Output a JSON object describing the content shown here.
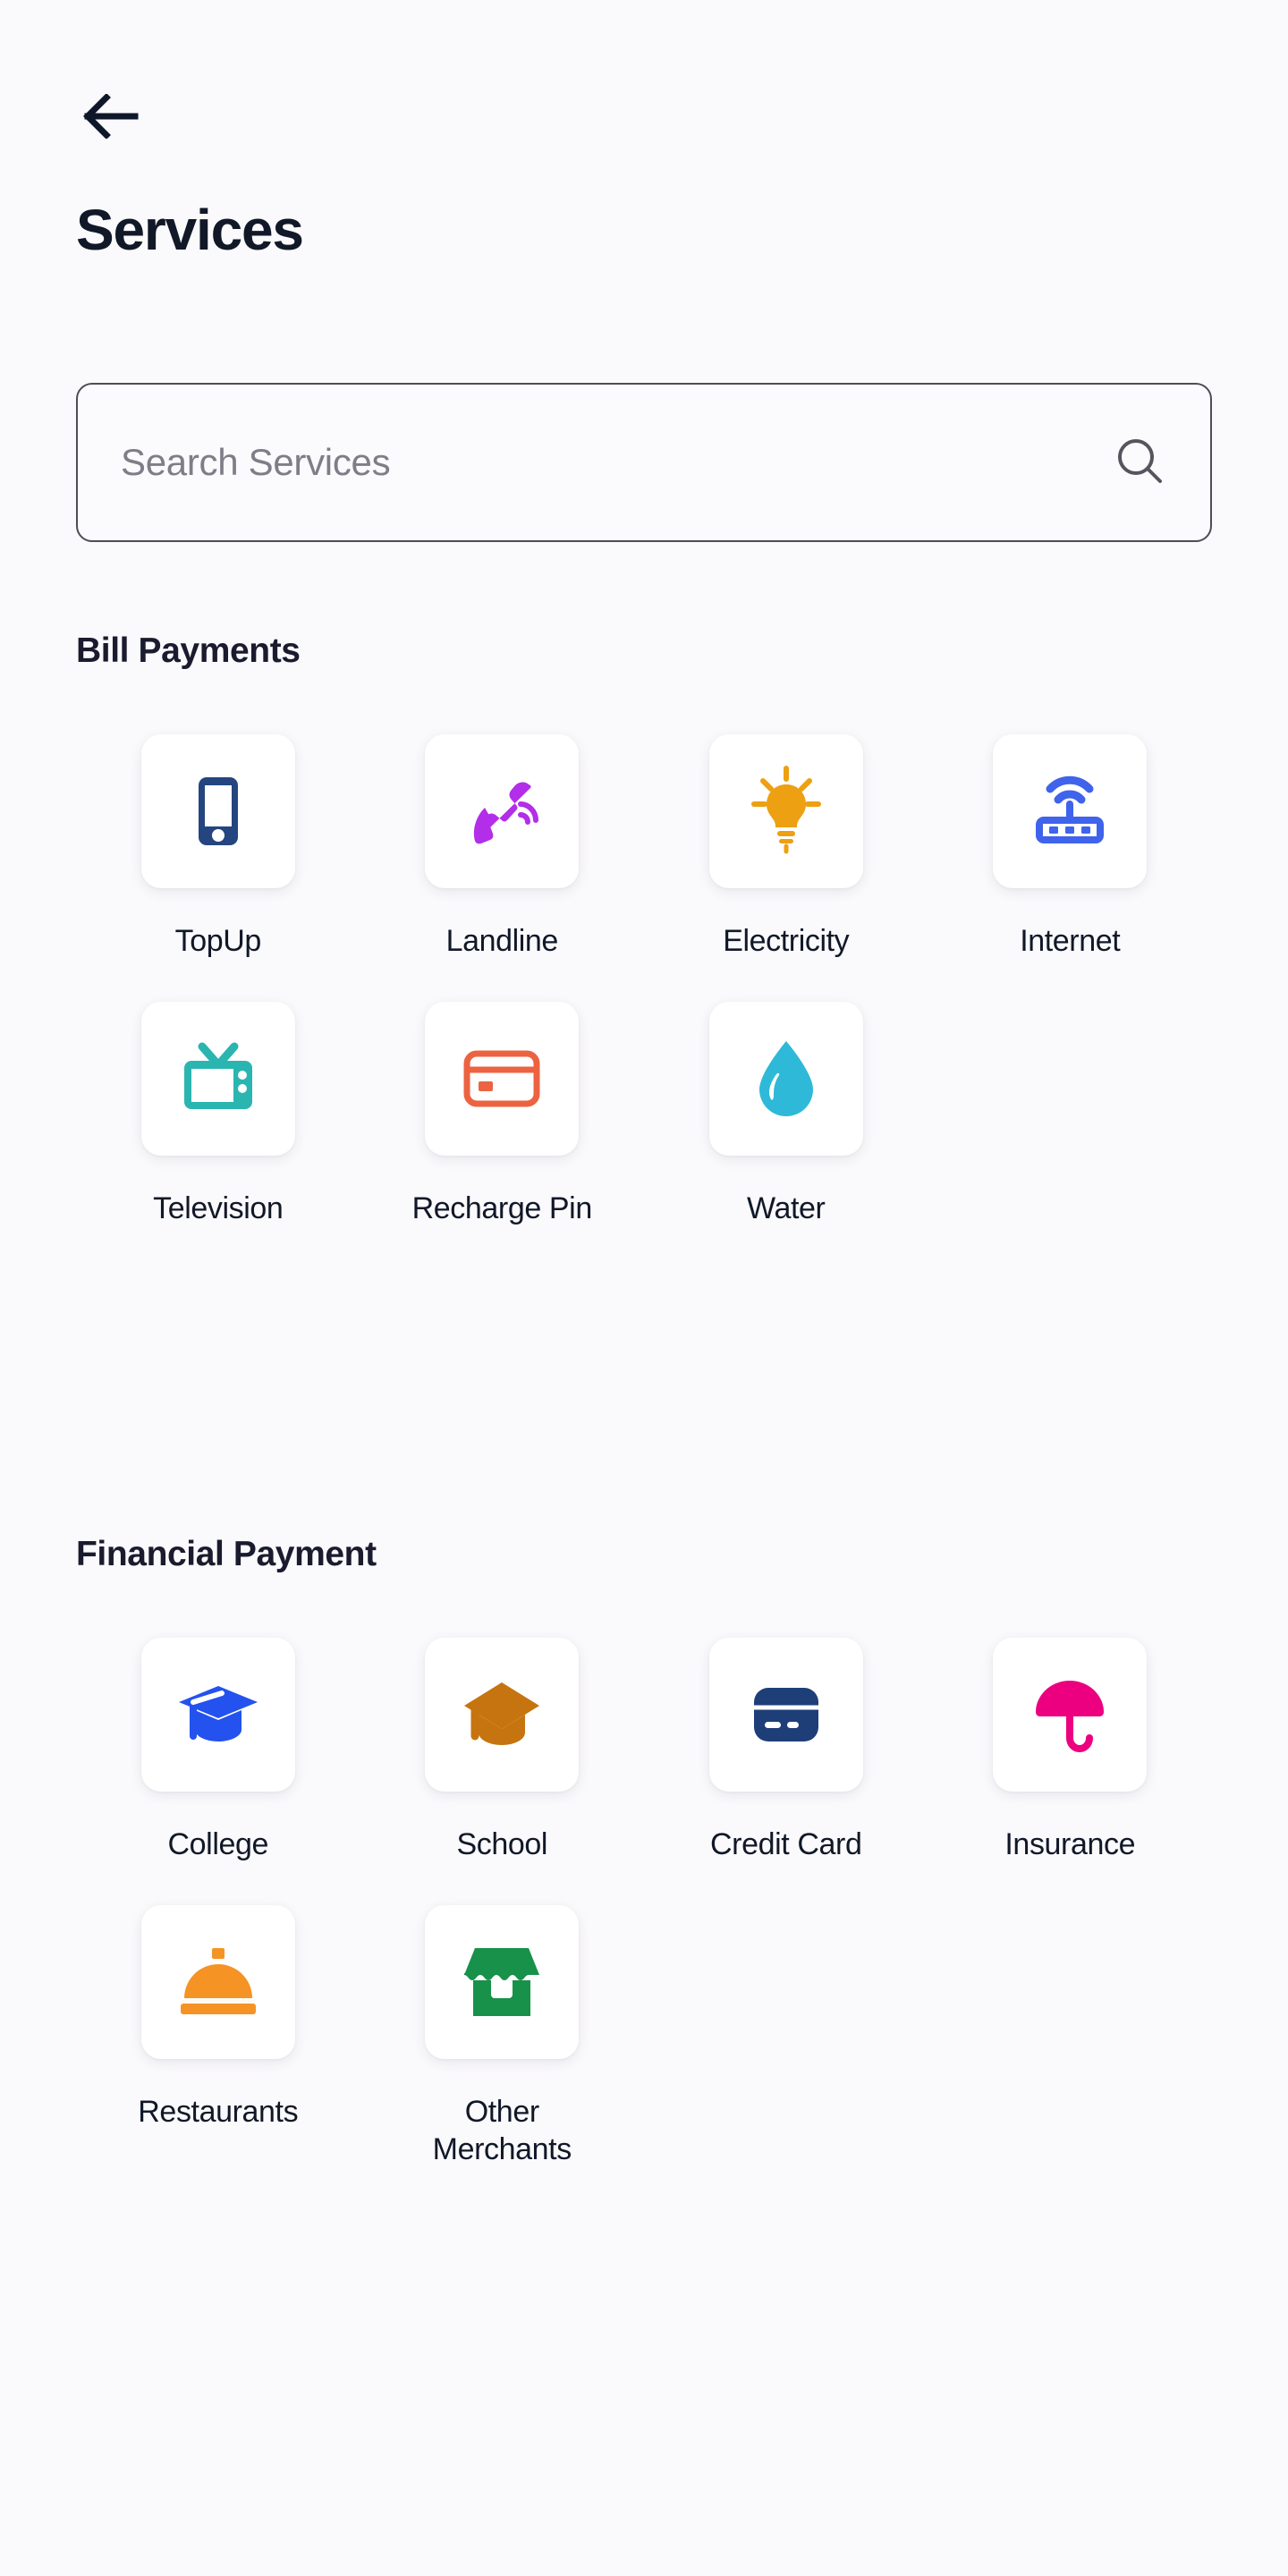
{
  "header": {
    "back_icon": "arrow-left-icon",
    "title": "Services"
  },
  "search": {
    "placeholder": "Search Services",
    "value": "",
    "icon": "search-icon"
  },
  "colors": {
    "background": "#faf9fb",
    "tile_background": "#ffffff",
    "text_primary": "#101828",
    "border": "#4d4d55",
    "placeholder": "#7e7e88"
  },
  "sections": [
    {
      "title": "Bill Payments",
      "items": [
        {
          "label": "TopUp",
          "icon": "smartphone-icon",
          "color": "#24457f"
        },
        {
          "label": "Landline",
          "icon": "phone-handset-icon",
          "color": "#b22ee8"
        },
        {
          "label": "Electricity",
          "icon": "lightbulb-icon",
          "color": "#eda012"
        },
        {
          "label": "Internet",
          "icon": "wifi-router-icon",
          "color": "#3f63eb"
        },
        {
          "label": "Television",
          "icon": "television-icon",
          "color": "#2bb5b0"
        },
        {
          "label": "Recharge Pin",
          "icon": "recharge-card-icon",
          "color": "#ec6341"
        },
        {
          "label": "Water",
          "icon": "water-drop-icon",
          "color": "#2eb9d8"
        }
      ]
    },
    {
      "title": "Financial Payment",
      "items": [
        {
          "label": "College",
          "icon": "graduation-cap-icon",
          "color": "#2352ef"
        },
        {
          "label": "School",
          "icon": "graduation-cap-icon",
          "color": "#c6740f"
        },
        {
          "label": "Credit Card",
          "icon": "credit-card-icon",
          "color": "#1e3e78"
        },
        {
          "label": "Insurance",
          "icon": "umbrella-icon",
          "color": "#ec0080"
        },
        {
          "label": "Restaurants",
          "icon": "food-cloche-icon",
          "color": "#f59324"
        },
        {
          "label": "Other Merchants",
          "icon": "storefront-icon",
          "color": "#18914a"
        }
      ]
    }
  ]
}
